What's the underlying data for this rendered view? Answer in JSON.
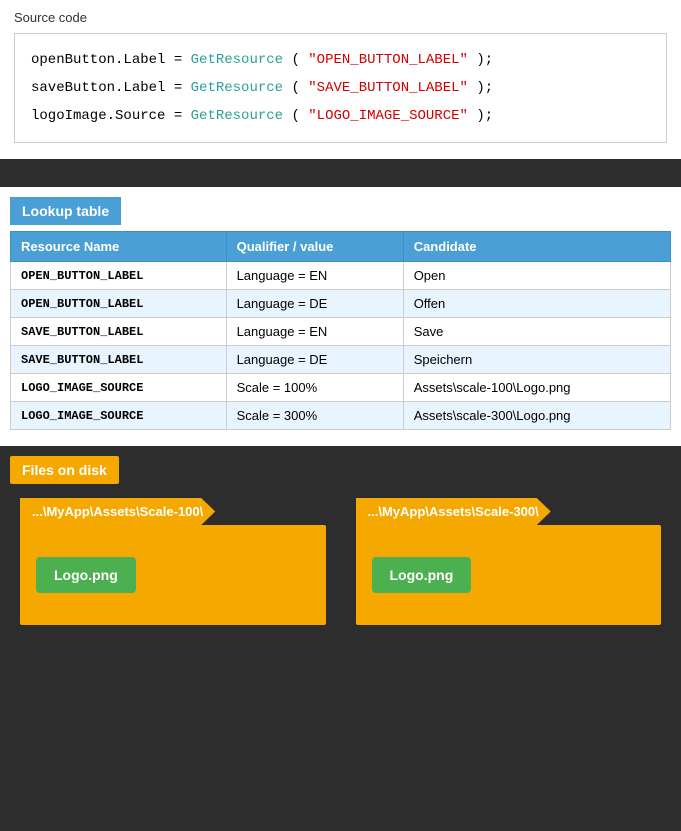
{
  "sourceCode": {
    "sectionLabel": "Source code",
    "lines": [
      {
        "var": "openButton.Label",
        "equals": " = ",
        "method": "GetResource",
        "openParen": "(",
        "string": "\"OPEN_BUTTON_LABEL\"",
        "closeParen": ");",
        "full": "openButton.Label = GetResource(\"OPEN_BUTTON_LABEL\");"
      },
      {
        "var": "saveButton.Label",
        "equals": " = ",
        "method": "GetResource",
        "string": "\"SAVE_BUTTON_LABEL\"",
        "full": "saveButton.Label = GetResource(\"SAVE_BUTTON_LABEL\");"
      },
      {
        "var": "logoImage.Source",
        "equals": " = ",
        "method": "GetResource",
        "string": "\"LOGO_IMAGE_SOURCE\"",
        "full": "logoImage.Source = GetResource(\"LOGO_IMAGE_SOURCE\");"
      }
    ]
  },
  "lookupTable": {
    "sectionLabel": "Lookup table",
    "columns": [
      "Resource Name",
      "Qualifier / value",
      "Candidate"
    ],
    "rows": [
      {
        "resourceName": "OPEN_BUTTON_LABEL",
        "qualifier": "Language = EN",
        "candidate": "Open"
      },
      {
        "resourceName": "OPEN_BUTTON_LABEL",
        "qualifier": "Language = DE",
        "candidate": "Offen"
      },
      {
        "resourceName": "SAVE_BUTTON_LABEL",
        "qualifier": "Language = EN",
        "candidate": "Save"
      },
      {
        "resourceName": "SAVE_BUTTON_LABEL",
        "qualifier": "Language = DE",
        "candidate": "Speichern"
      },
      {
        "resourceName": "LOGO_IMAGE_SOURCE",
        "qualifier": "Scale = 100%",
        "candidate": "Assets\\scale-100\\Logo.png"
      },
      {
        "resourceName": "LOGO_IMAGE_SOURCE",
        "qualifier": "Scale = 300%",
        "candidate": "Assets\\scale-300\\Logo.png"
      }
    ]
  },
  "filesOnDisk": {
    "sectionLabel": "Files on disk",
    "folders": [
      {
        "path": "...\\MyApp\\Assets\\Scale-100\\",
        "file": "Logo.png"
      },
      {
        "path": "...\\MyApp\\Assets\\Scale-300\\",
        "file": "Logo.png"
      }
    ]
  }
}
